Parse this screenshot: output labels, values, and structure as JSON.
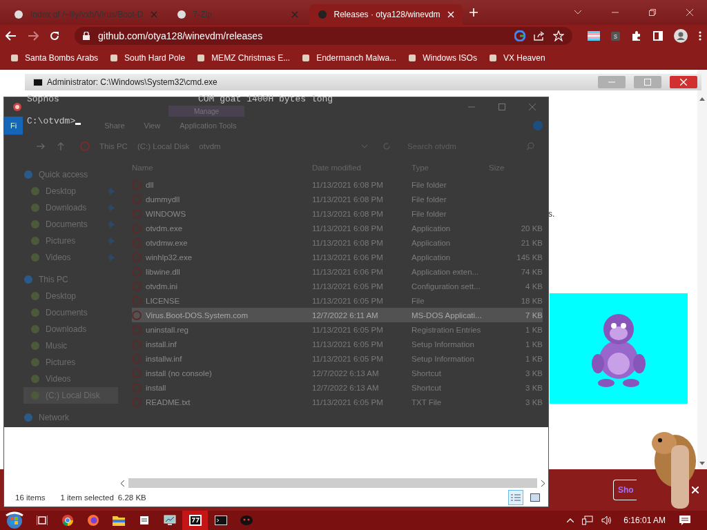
{
  "browser": {
    "tabs": [
      {
        "title": "Index of /~lily/vxh/Virus/Boot-D",
        "selected": false
      },
      {
        "title": "7-Zip",
        "selected": false
      },
      {
        "title": "Releases · otya128/winevdm",
        "selected": true
      }
    ],
    "address": "github.com/otya128/winevdm/releases",
    "extension_badge": "s",
    "bookmarks": [
      "Santa Bombs Arabs",
      "South Hard Pole",
      "MEMZ Christmas E...",
      "Endermanch Malwa...",
      "Windows ISOs",
      "VX Heaven"
    ]
  },
  "page": {
    "text_fragment": "s.",
    "banner_button": "Sho"
  },
  "cmd": {
    "title": "Administrator: C:\\Windows\\System32\\cmd.exe",
    "output_left": "Sophos",
    "output_right": "COM goat 1400H bytes long",
    "prompt": "C:\\otvdm>"
  },
  "explorer": {
    "context_tab": "Manage",
    "ribbon_tabs": [
      {
        "label": "Fi",
        "selected": true
      },
      {
        "label": "Share",
        "selected": false
      },
      {
        "label": "View",
        "selected": false
      },
      {
        "label": "Application Tools",
        "selected": false
      }
    ],
    "breadcrumb": [
      "This PC",
      "(C:) Local Disk",
      "otvdm"
    ],
    "search": {
      "placeholder": "Search otvdm"
    },
    "sidebar": [
      {
        "label": "Quick access",
        "selected": false,
        "children": [
          {
            "label": "Desktop",
            "pinned": true,
            "selected": false
          },
          {
            "label": "Downloads",
            "pinned": true,
            "selected": false
          },
          {
            "label": "Documents",
            "pinned": true,
            "selected": false
          },
          {
            "label": "Pictures",
            "pinned": true,
            "selected": false
          },
          {
            "label": "Videos",
            "pinned": true,
            "selected": false
          }
        ]
      },
      {
        "label": "This PC",
        "selected": false,
        "children": [
          {
            "label": "Desktop",
            "pinned": false,
            "selected": false
          },
          {
            "label": "Documents",
            "pinned": false,
            "selected": false
          },
          {
            "label": "Downloads",
            "pinned": false,
            "selected": false
          },
          {
            "label": "Music",
            "pinned": false,
            "selected": false
          },
          {
            "label": "Pictures",
            "pinned": false,
            "selected": false
          },
          {
            "label": "Videos",
            "pinned": false,
            "selected": false
          },
          {
            "label": "(C:) Local Disk",
            "pinned": false,
            "selected": true
          }
        ]
      },
      {
        "label": "Network",
        "selected": false
      }
    ],
    "columns": [
      "Name",
      "Date modified",
      "Type",
      "Size"
    ],
    "files": [
      {
        "name": "dll",
        "date": "11/13/2021 6:08 PM",
        "type": "File folder",
        "selected": false
      },
      {
        "name": "dummydll",
        "date": "11/13/2021 6:08 PM",
        "type": "File folder",
        "selected": false
      },
      {
        "name": "WINDOWS",
        "date": "11/13/2021 6:08 PM",
        "type": "File folder",
        "selected": false
      },
      {
        "name": "otvdm.exe",
        "date": "11/13/2021 6:08 PM",
        "type": "Application",
        "size": "20 KB",
        "selected": false
      },
      {
        "name": "otvdmw.exe",
        "date": "11/13/2021 6:08 PM",
        "type": "Application",
        "size": "21 KB",
        "selected": false
      },
      {
        "name": "winhlp32.exe",
        "date": "11/13/2021 6:06 PM",
        "type": "Application",
        "size": "145 KB",
        "selected": false
      },
      {
        "name": "libwine.dll",
        "date": "11/13/2021 6:06 PM",
        "type": "Application exten...",
        "size": "74 KB",
        "selected": false
      },
      {
        "name": "otvdm.ini",
        "date": "11/13/2021 6:05 PM",
        "type": "Configuration sett...",
        "size": "4 KB",
        "selected": false
      },
      {
        "name": "LICENSE",
        "date": "11/13/2021 6:05 PM",
        "type": "File",
        "size": "18 KB",
        "selected": false
      },
      {
        "name": "Virus.Boot-DOS.System.com",
        "date": "12/7/2022 6:11 AM",
        "type": "MS-DOS Applicati...",
        "size": "7 KB",
        "selected": true
      },
      {
        "name": "uninstall.reg",
        "date": "11/13/2021 6:05 PM",
        "type": "Registration Entries",
        "size": "1 KB",
        "selected": false
      },
      {
        "name": "install.inf",
        "date": "11/13/2021 6:05 PM",
        "type": "Setup Information",
        "size": "1 KB",
        "selected": false
      },
      {
        "name": "installw.inf",
        "date": "11/13/2021 6:05 PM",
        "type": "Setup Information",
        "size": "1 KB",
        "selected": false
      },
      {
        "name": "install (no console)",
        "date": "12/7/2022 6:13 AM",
        "type": "Shortcut",
        "size": "3 KB",
        "selected": false
      },
      {
        "name": "install",
        "date": "12/7/2022 6:13 AM",
        "type": "Shortcut",
        "size": "3 KB",
        "selected": false
      },
      {
        "name": "README.txt",
        "date": "11/13/2021 6:05 PM",
        "type": "TXT File",
        "size": "3 KB",
        "selected": false
      }
    ],
    "status": {
      "count": "16 items",
      "selection": "1 item selected",
      "size": "6.28 KB"
    },
    "views": [
      {
        "kind": "details",
        "selected": true
      },
      {
        "kind": "large-icons",
        "selected": false
      }
    ]
  },
  "taskbar": {
    "apps": [
      {
        "kind": "task-view",
        "selected": false
      },
      {
        "kind": "chrome",
        "selected": false
      },
      {
        "kind": "firefox",
        "selected": false
      },
      {
        "kind": "folder",
        "selected": false
      },
      {
        "kind": "file",
        "selected": false
      },
      {
        "kind": "monitor",
        "selected": false
      },
      {
        "kind": "archive",
        "selected": true
      },
      {
        "kind": "console",
        "selected": false
      },
      {
        "kind": "blob",
        "selected": false
      }
    ],
    "clock": "6:16:01 AM"
  }
}
